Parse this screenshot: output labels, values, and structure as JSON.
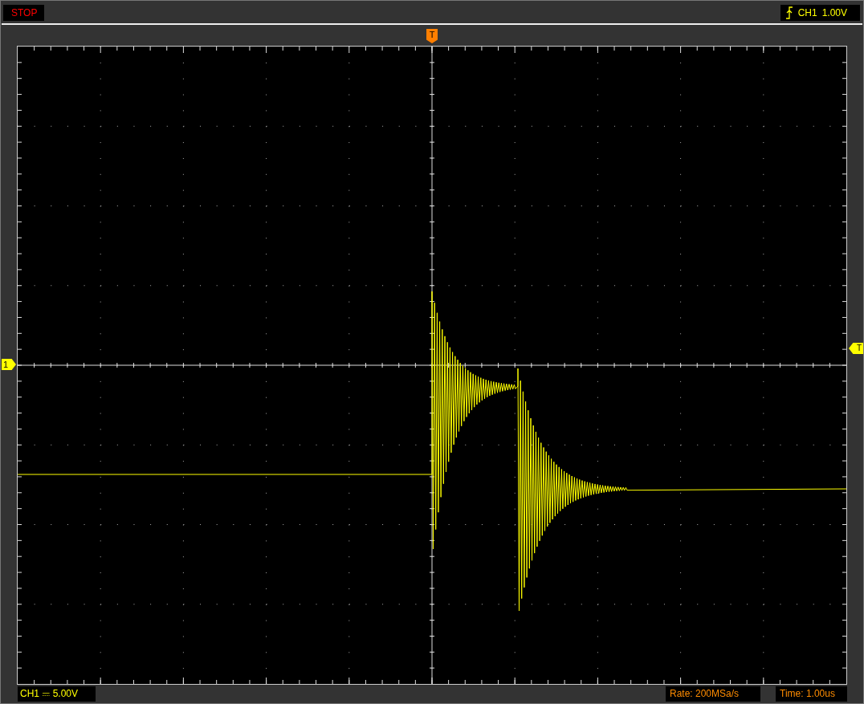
{
  "status": {
    "text": "STOP"
  },
  "trigger_info": {
    "channel": "CH1",
    "level": "1.00V"
  },
  "markers": {
    "trigger_position": "T",
    "channel": "1",
    "trigger_level": "T"
  },
  "footer": {
    "channel": "CH1",
    "scale": "5.00V",
    "rate": "Rate: 200MSa/s",
    "time": "Time: 1.00us"
  }
}
